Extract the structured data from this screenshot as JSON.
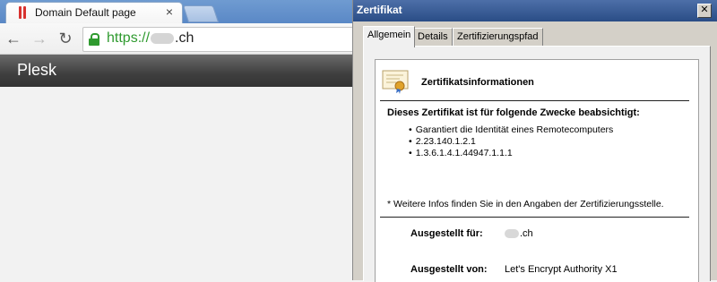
{
  "browser": {
    "tab": {
      "title": "Domain Default page",
      "close_glyph": "×",
      "favicon": "plesk-favicon"
    },
    "nav": {
      "back_icon": "←",
      "forward_icon": "→",
      "reload_icon": "↻"
    },
    "address": {
      "scheme": "https://",
      "domain_suffix": ".ch",
      "secure_color": "#2f9a2f"
    },
    "page": {
      "header_title": "Plesk"
    }
  },
  "dialog": {
    "title": "Zertifikat",
    "close_glyph": "✕",
    "tabs": [
      {
        "label": "Allgemein",
        "active": true
      },
      {
        "label": "Details",
        "active": false
      },
      {
        "label": "Zertifizierungspfad",
        "active": false
      }
    ],
    "general": {
      "info_title": "Zertifikatsinformationen",
      "purpose_heading": "Dieses Zertifikat ist für folgende Zwecke beabsichtigt:",
      "purposes": [
        "Garantiert die Identität eines Remotecomputers",
        "2.23.140.1.2.1",
        "1.3.6.1.4.1.44947.1.1.1"
      ],
      "note": "* Weitere Infos finden Sie in den Angaben der Zertifizierungsstelle.",
      "issued_to_label": "Ausgestellt für:",
      "issued_to_value_suffix": ".ch",
      "issued_by_label": "Ausgestellt von:",
      "issued_by_value": "Let's Encrypt Authority X1"
    }
  }
}
